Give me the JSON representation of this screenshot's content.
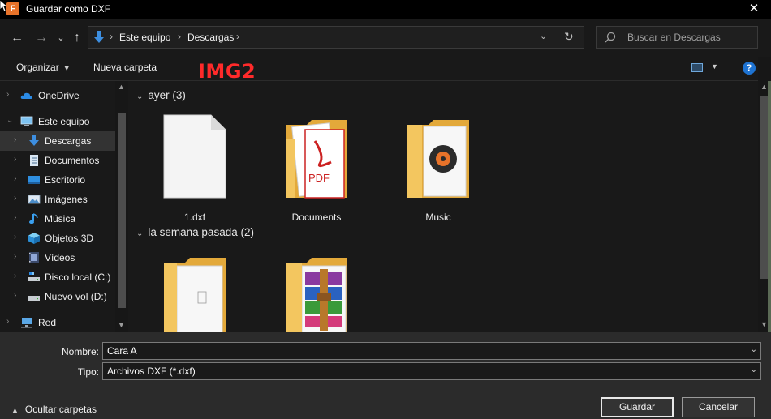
{
  "window": {
    "title": "Guardar como DXF",
    "close_glyph": "✕"
  },
  "nav": {
    "back_glyph": "←",
    "forward_glyph": "→",
    "recent_glyph": "⌄",
    "up_glyph": "↑",
    "breadcrumb": [
      "Este equipo",
      "Descargas"
    ],
    "crumb_sep": "›",
    "dropdown_glyph": "⌄",
    "refresh_glyph": "↻",
    "search_placeholder": "Buscar en Descargas"
  },
  "toolbar": {
    "organize_label": "Organizar",
    "organize_caret": "▼",
    "new_folder_label": "Nueva carpeta",
    "overlay_label": "IMG2",
    "view_caret": "▼",
    "help_glyph": "?"
  },
  "sidebar": {
    "chevron": "›",
    "expanded_chevron": "⌄",
    "items": [
      {
        "label": "OneDrive",
        "icon": "cloud-icon"
      },
      {
        "label": "Este equipo",
        "icon": "computer-icon"
      },
      {
        "label": "Descargas",
        "icon": "download-icon"
      },
      {
        "label": "Documentos",
        "icon": "document-icon"
      },
      {
        "label": "Escritorio",
        "icon": "desktop-icon"
      },
      {
        "label": "Imágenes",
        "icon": "image-icon"
      },
      {
        "label": "Música",
        "icon": "music-icon"
      },
      {
        "label": "Objetos 3D",
        "icon": "cube-icon"
      },
      {
        "label": "Vídeos",
        "icon": "video-icon"
      },
      {
        "label": "Disco local (C:)",
        "icon": "drive-icon"
      },
      {
        "label": "Nuevo vol (D:)",
        "icon": "drive-icon"
      },
      {
        "label": "Red",
        "icon": "network-icon"
      }
    ],
    "scroll_up": "▲",
    "scroll_down": "▼"
  },
  "content": {
    "groups": [
      {
        "title": "ayer (3)",
        "chevron": "⌄",
        "files": [
          {
            "label": "1.dxf",
            "icon": "blank-file-icon"
          },
          {
            "label": "Documents",
            "icon": "pdf-folder-icon"
          },
          {
            "label": "Music",
            "icon": "music-folder-icon"
          }
        ]
      },
      {
        "title": "la semana pasada (2)",
        "chevron": "⌄",
        "files": [
          {
            "label": "",
            "icon": "document-folder-icon"
          },
          {
            "label": "",
            "icon": "archive-folder-icon"
          }
        ]
      }
    ],
    "pdf_text": "PDF",
    "scroll_up": "▲",
    "scroll_down": "▼"
  },
  "bottom": {
    "name_label": "Nombre:",
    "name_value": "Cara A",
    "type_label": "Tipo:",
    "type_value": "Archivos DXF (*.dxf)",
    "field_caret": "⌄",
    "hide_folders_label": "Ocultar carpetas",
    "hide_folders_caret": "▲",
    "save_label": "Guardar",
    "cancel_label": "Cancelar"
  },
  "colors": {
    "background": "#191919",
    "panel": "#2b2b2b",
    "accent_blue": "#1e73d2",
    "folder_yellow": "#f3c65f",
    "overlay_red": "#ff2a2a"
  }
}
